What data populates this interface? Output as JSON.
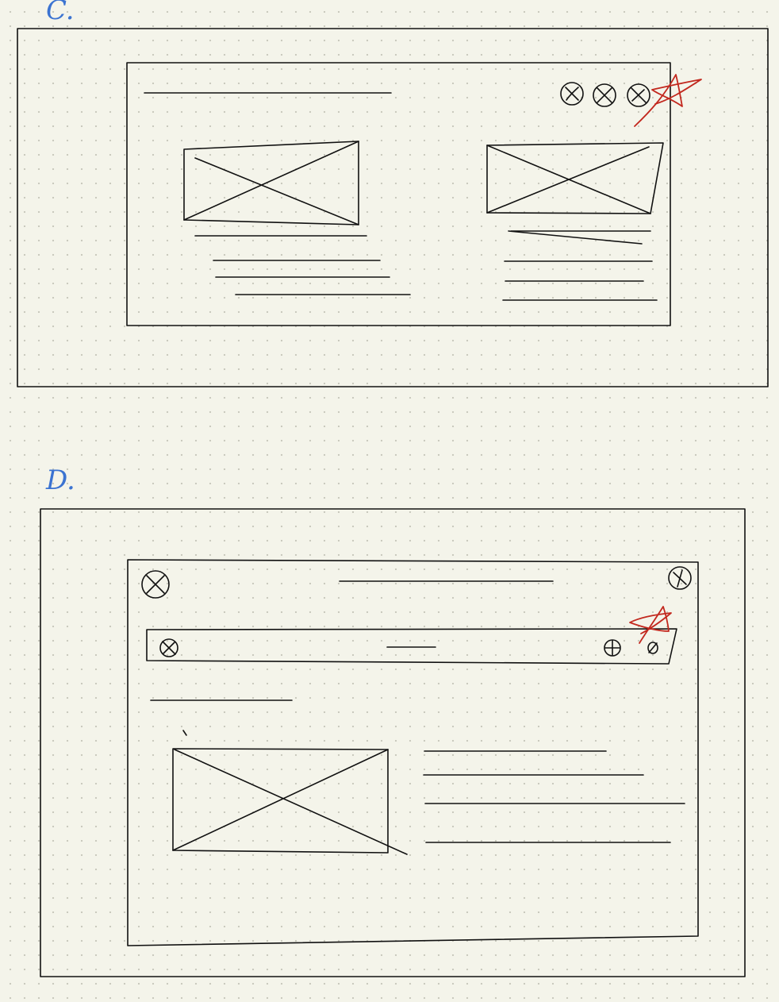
{
  "sections": [
    {
      "id": "c",
      "label": "C.",
      "rejected": true
    },
    {
      "id": "d",
      "label": "D.",
      "rejected": true
    }
  ],
  "colors": {
    "paper": "#f4f4ea",
    "ink": "#111111",
    "label_blue": "#3b73d1",
    "reject_red": "#c2281e"
  },
  "icons": {
    "placeholder_image": "x-box",
    "button_circle": "circled-x",
    "rejection_mark": "red-scribble-star"
  }
}
